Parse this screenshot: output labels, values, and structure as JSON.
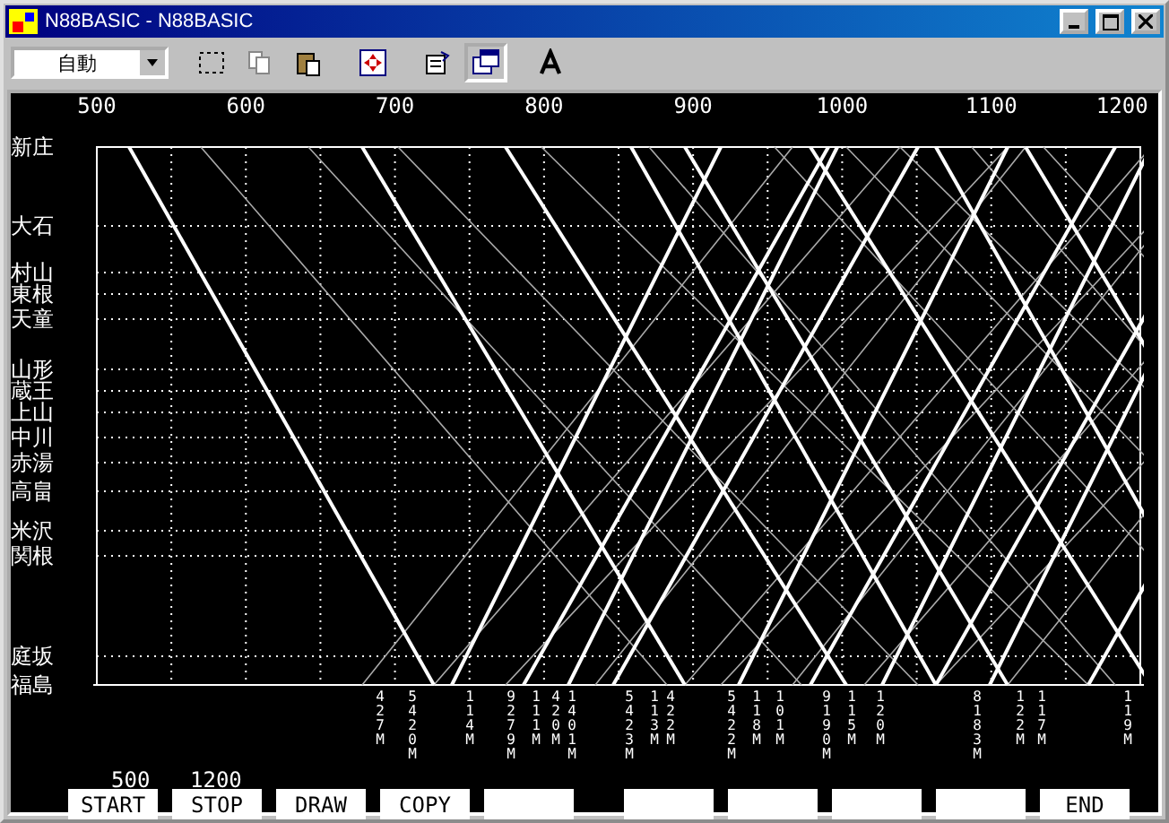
{
  "window": {
    "title": "N88BASIC - N88BASIC"
  },
  "toolbar": {
    "font_select": "自動"
  },
  "axis": {
    "ticks": [
      "500",
      "600",
      "700",
      "800",
      "900",
      "1000",
      "1100",
      "1200"
    ]
  },
  "stations": [
    "新庄",
    "大石",
    "村山",
    "東根",
    "天童",
    "山形",
    "蔵王",
    "上山",
    "中川",
    "赤湯",
    "高畠",
    "米沢",
    "関根",
    "庭坂",
    "福島"
  ],
  "trains": [
    "427M",
    "5420M",
    "114M",
    "9279M",
    "111M",
    "420M",
    "1401M",
    "5423M",
    "113M",
    "422M",
    "5422M",
    "118M",
    "101M",
    "9190M",
    "115M",
    "120M",
    "8183M",
    "122M",
    "117M",
    "119M"
  ],
  "range": {
    "start": "500",
    "stop": "1200"
  },
  "function_keys": [
    {
      "kind": "labeled",
      "label": "START"
    },
    {
      "kind": "labeled",
      "label": "STOP"
    },
    {
      "kind": "labeled",
      "label": "DRAW"
    },
    {
      "kind": "labeled",
      "label": "COPY"
    },
    {
      "kind": "blank"
    },
    {
      "kind": "blank"
    },
    {
      "kind": "blank"
    },
    {
      "kind": "blank"
    },
    {
      "kind": "blank"
    },
    {
      "kind": "labeled",
      "label": "END"
    }
  ]
}
